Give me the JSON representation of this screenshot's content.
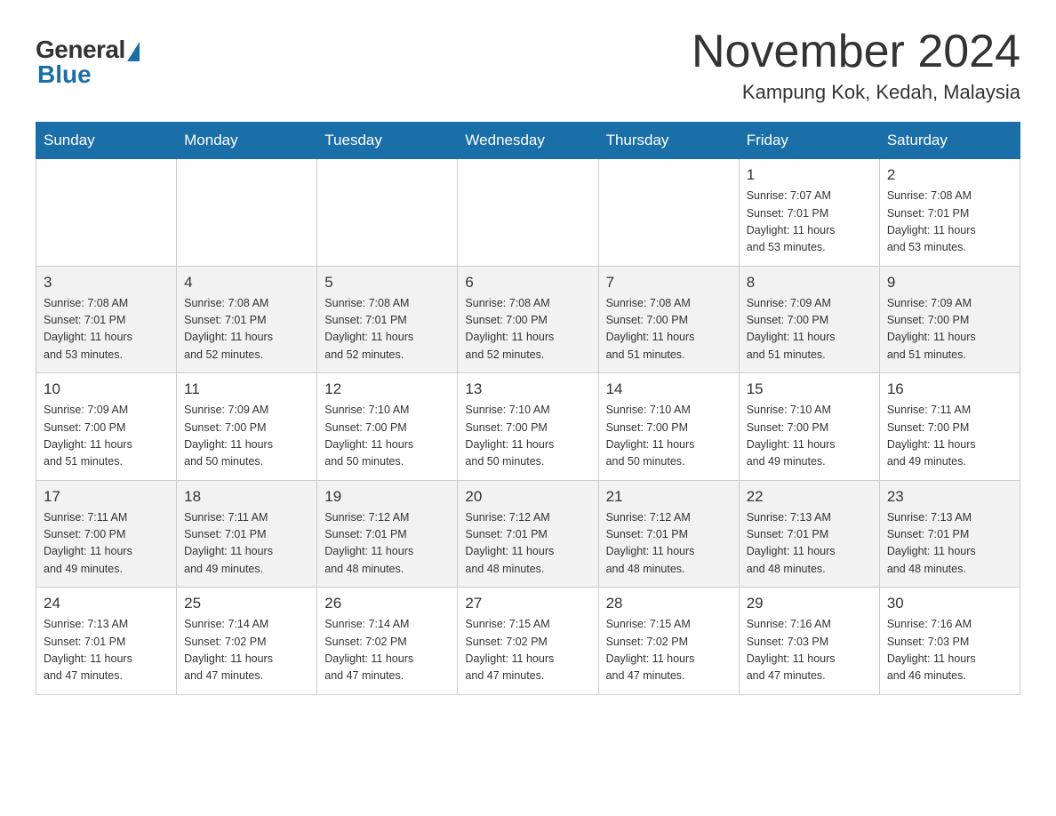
{
  "header": {
    "logo_general": "General",
    "logo_blue": "Blue",
    "month_title": "November 2024",
    "location": "Kampung Kok, Kedah, Malaysia"
  },
  "days_of_week": [
    "Sunday",
    "Monday",
    "Tuesday",
    "Wednesday",
    "Thursday",
    "Friday",
    "Saturday"
  ],
  "weeks": [
    [
      {
        "day": "",
        "info": ""
      },
      {
        "day": "",
        "info": ""
      },
      {
        "day": "",
        "info": ""
      },
      {
        "day": "",
        "info": ""
      },
      {
        "day": "",
        "info": ""
      },
      {
        "day": "1",
        "info": "Sunrise: 7:07 AM\nSunset: 7:01 PM\nDaylight: 11 hours\nand 53 minutes."
      },
      {
        "day": "2",
        "info": "Sunrise: 7:08 AM\nSunset: 7:01 PM\nDaylight: 11 hours\nand 53 minutes."
      }
    ],
    [
      {
        "day": "3",
        "info": "Sunrise: 7:08 AM\nSunset: 7:01 PM\nDaylight: 11 hours\nand 53 minutes."
      },
      {
        "day": "4",
        "info": "Sunrise: 7:08 AM\nSunset: 7:01 PM\nDaylight: 11 hours\nand 52 minutes."
      },
      {
        "day": "5",
        "info": "Sunrise: 7:08 AM\nSunset: 7:01 PM\nDaylight: 11 hours\nand 52 minutes."
      },
      {
        "day": "6",
        "info": "Sunrise: 7:08 AM\nSunset: 7:00 PM\nDaylight: 11 hours\nand 52 minutes."
      },
      {
        "day": "7",
        "info": "Sunrise: 7:08 AM\nSunset: 7:00 PM\nDaylight: 11 hours\nand 51 minutes."
      },
      {
        "day": "8",
        "info": "Sunrise: 7:09 AM\nSunset: 7:00 PM\nDaylight: 11 hours\nand 51 minutes."
      },
      {
        "day": "9",
        "info": "Sunrise: 7:09 AM\nSunset: 7:00 PM\nDaylight: 11 hours\nand 51 minutes."
      }
    ],
    [
      {
        "day": "10",
        "info": "Sunrise: 7:09 AM\nSunset: 7:00 PM\nDaylight: 11 hours\nand 51 minutes."
      },
      {
        "day": "11",
        "info": "Sunrise: 7:09 AM\nSunset: 7:00 PM\nDaylight: 11 hours\nand 50 minutes."
      },
      {
        "day": "12",
        "info": "Sunrise: 7:10 AM\nSunset: 7:00 PM\nDaylight: 11 hours\nand 50 minutes."
      },
      {
        "day": "13",
        "info": "Sunrise: 7:10 AM\nSunset: 7:00 PM\nDaylight: 11 hours\nand 50 minutes."
      },
      {
        "day": "14",
        "info": "Sunrise: 7:10 AM\nSunset: 7:00 PM\nDaylight: 11 hours\nand 50 minutes."
      },
      {
        "day": "15",
        "info": "Sunrise: 7:10 AM\nSunset: 7:00 PM\nDaylight: 11 hours\nand 49 minutes."
      },
      {
        "day": "16",
        "info": "Sunrise: 7:11 AM\nSunset: 7:00 PM\nDaylight: 11 hours\nand 49 minutes."
      }
    ],
    [
      {
        "day": "17",
        "info": "Sunrise: 7:11 AM\nSunset: 7:00 PM\nDaylight: 11 hours\nand 49 minutes."
      },
      {
        "day": "18",
        "info": "Sunrise: 7:11 AM\nSunset: 7:01 PM\nDaylight: 11 hours\nand 49 minutes."
      },
      {
        "day": "19",
        "info": "Sunrise: 7:12 AM\nSunset: 7:01 PM\nDaylight: 11 hours\nand 48 minutes."
      },
      {
        "day": "20",
        "info": "Sunrise: 7:12 AM\nSunset: 7:01 PM\nDaylight: 11 hours\nand 48 minutes."
      },
      {
        "day": "21",
        "info": "Sunrise: 7:12 AM\nSunset: 7:01 PM\nDaylight: 11 hours\nand 48 minutes."
      },
      {
        "day": "22",
        "info": "Sunrise: 7:13 AM\nSunset: 7:01 PM\nDaylight: 11 hours\nand 48 minutes."
      },
      {
        "day": "23",
        "info": "Sunrise: 7:13 AM\nSunset: 7:01 PM\nDaylight: 11 hours\nand 48 minutes."
      }
    ],
    [
      {
        "day": "24",
        "info": "Sunrise: 7:13 AM\nSunset: 7:01 PM\nDaylight: 11 hours\nand 47 minutes."
      },
      {
        "day": "25",
        "info": "Sunrise: 7:14 AM\nSunset: 7:02 PM\nDaylight: 11 hours\nand 47 minutes."
      },
      {
        "day": "26",
        "info": "Sunrise: 7:14 AM\nSunset: 7:02 PM\nDaylight: 11 hours\nand 47 minutes."
      },
      {
        "day": "27",
        "info": "Sunrise: 7:15 AM\nSunset: 7:02 PM\nDaylight: 11 hours\nand 47 minutes."
      },
      {
        "day": "28",
        "info": "Sunrise: 7:15 AM\nSunset: 7:02 PM\nDaylight: 11 hours\nand 47 minutes."
      },
      {
        "day": "29",
        "info": "Sunrise: 7:16 AM\nSunset: 7:03 PM\nDaylight: 11 hours\nand 47 minutes."
      },
      {
        "day": "30",
        "info": "Sunrise: 7:16 AM\nSunset: 7:03 PM\nDaylight: 11 hours\nand 46 minutes."
      }
    ]
  ]
}
